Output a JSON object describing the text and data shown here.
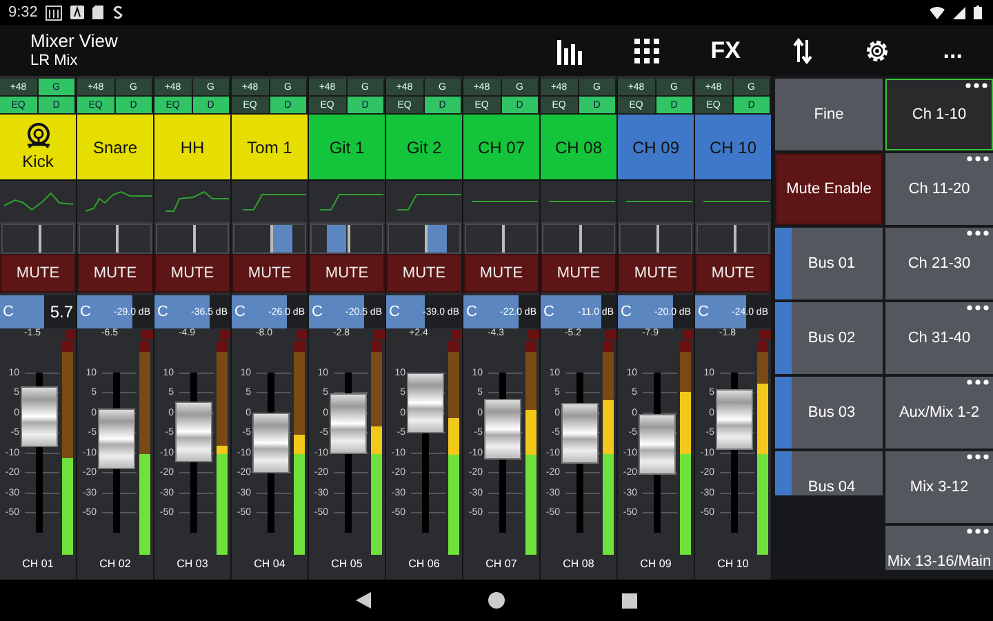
{
  "status_bar": {
    "time": "9:32"
  },
  "app_bar": {
    "title": "Mixer View",
    "subtitle": "LR Mix",
    "actions": [
      {
        "kind": "meters"
      },
      {
        "kind": "grid"
      },
      {
        "kind": "text",
        "label": "FX"
      },
      {
        "kind": "swap"
      },
      {
        "kind": "settings"
      },
      {
        "kind": "text",
        "label": "..."
      }
    ]
  },
  "channels": [
    {
      "phantom": {
        "label": "+48",
        "on": false
      },
      "gate": {
        "label": "G",
        "on": true
      },
      "eq": {
        "label": "EQ",
        "on": true
      },
      "dyn": {
        "label": "D",
        "on": true
      },
      "name": "Kick",
      "color": "#e6de00",
      "icon": true,
      "eq_graph": {
        "kind": "peaking"
      },
      "width_indicator": {
        "kind": "none"
      },
      "mute": {
        "label": "MUTE",
        "on": false
      },
      "trim": {
        "pan": "C",
        "text": "5.7",
        "level": 0.58,
        "selected": true
      },
      "readout": "-1.5",
      "scale": [
        "10",
        "5",
        "0",
        "-5",
        "-10",
        "-20",
        "-30",
        "-50"
      ],
      "fader": {
        "level": 0.72
      },
      "meter": {
        "level": 0.45
      },
      "label": "CH 01"
    },
    {
      "phantom": {
        "label": "+48",
        "on": false
      },
      "gate": {
        "label": "G",
        "on": false
      },
      "eq": {
        "label": "EQ",
        "on": true
      },
      "dyn": {
        "label": "D",
        "on": true
      },
      "name": "Snare",
      "color": "#e6de00",
      "icon": false,
      "eq_graph": {
        "kind": "shelf"
      },
      "width_indicator": {
        "kind": "none"
      },
      "mute": {
        "label": "MUTE",
        "on": false
      },
      "trim": {
        "pan": "C",
        "text": "-29.0 dB",
        "level": 0.72,
        "selected": false
      },
      "readout": "-6.5",
      "scale": [
        "10",
        "5",
        "0",
        "-5",
        "-10",
        "-20",
        "-30",
        "-50"
      ],
      "fader": {
        "level": 0.59
      },
      "meter": {
        "level": 0.47
      },
      "label": "CH 02"
    },
    {
      "phantom": {
        "label": "+48",
        "on": false
      },
      "gate": {
        "label": "G",
        "on": false
      },
      "eq": {
        "label": "EQ",
        "on": true
      },
      "dyn": {
        "label": "D",
        "on": true
      },
      "name": "HH",
      "color": "#e6de00",
      "icon": false,
      "eq_graph": {
        "kind": "highpass-bump"
      },
      "width_indicator": {
        "kind": "none"
      },
      "mute": {
        "label": "MUTE",
        "on": false
      },
      "trim": {
        "pan": "C",
        "text": "-36.5 dB",
        "level": 0.72,
        "selected": false
      },
      "readout": "-4.9",
      "scale": [
        "10",
        "5",
        "0",
        "-5",
        "-10",
        "-20",
        "-30",
        "-50"
      ],
      "fader": {
        "level": 0.63
      },
      "meter": {
        "level": 0.51
      },
      "label": "CH 03"
    },
    {
      "phantom": {
        "label": "+48",
        "on": false
      },
      "gate": {
        "label": "G",
        "on": false
      },
      "eq": {
        "label": "EQ",
        "on": false
      },
      "dyn": {
        "label": "D",
        "on": true
      },
      "name": "Tom 1",
      "color": "#e6de00",
      "icon": false,
      "eq_graph": {
        "kind": "highpass"
      },
      "width_indicator": {
        "kind": "right"
      },
      "mute": {
        "label": "MUTE",
        "on": false
      },
      "trim": {
        "pan": "C",
        "text": "-26.0 dB",
        "level": 0.72,
        "selected": false
      },
      "readout": "-8.0",
      "scale": [
        "10",
        "5",
        "0",
        "-5",
        "-10",
        "-20",
        "-30",
        "-50"
      ],
      "fader": {
        "level": 0.56
      },
      "meter": {
        "level": 0.56
      },
      "label": "CH 04"
    },
    {
      "phantom": {
        "label": "+48",
        "on": false
      },
      "gate": {
        "label": "G",
        "on": false
      },
      "eq": {
        "label": "EQ",
        "on": false
      },
      "dyn": {
        "label": "D",
        "on": true
      },
      "name": "Git 1",
      "color": "#14c43a",
      "icon": false,
      "eq_graph": {
        "kind": "highpass"
      },
      "width_indicator": {
        "kind": "left"
      },
      "mute": {
        "label": "MUTE",
        "on": false
      },
      "trim": {
        "pan": "C",
        "text": "-20.5 dB",
        "level": 0.72,
        "selected": false
      },
      "readout": "-2.8",
      "scale": [
        "10",
        "5",
        "0",
        "-5",
        "-10",
        "-20",
        "-30",
        "-50"
      ],
      "fader": {
        "level": 0.68
      },
      "meter": {
        "level": 0.6
      },
      "label": "CH 05"
    },
    {
      "phantom": {
        "label": "+48",
        "on": false
      },
      "gate": {
        "label": "G",
        "on": false
      },
      "eq": {
        "label": "EQ",
        "on": false
      },
      "dyn": {
        "label": "D",
        "on": true
      },
      "name": "Git 2",
      "color": "#14c43a",
      "icon": false,
      "eq_graph": {
        "kind": "highpass"
      },
      "width_indicator": {
        "kind": "right"
      },
      "mute": {
        "label": "MUTE",
        "on": false
      },
      "trim": {
        "pan": "C",
        "text": "-39.0 dB",
        "level": 0.5,
        "selected": false
      },
      "readout": "+2.4",
      "scale": [
        "10",
        "5",
        "0",
        "-5",
        "-10",
        "-20",
        "-30",
        "-50"
      ],
      "fader": {
        "level": 0.81
      },
      "meter": {
        "level": 0.64
      },
      "label": "CH 06"
    },
    {
      "phantom": {
        "label": "+48",
        "on": false
      },
      "gate": {
        "label": "G",
        "on": false
      },
      "eq": {
        "label": "EQ",
        "on": false
      },
      "dyn": {
        "label": "D",
        "on": true
      },
      "name": "CH 07",
      "color": "#14c43a",
      "icon": false,
      "eq_graph": {
        "kind": "flat"
      },
      "width_indicator": {
        "kind": "none"
      },
      "mute": {
        "label": "MUTE",
        "on": false
      },
      "trim": {
        "pan": "C",
        "text": "-22.0 dB",
        "level": 0.72,
        "selected": false
      },
      "readout": "-4.3",
      "scale": [
        "10",
        "5",
        "0",
        "-5",
        "-10",
        "-20",
        "-30",
        "-50"
      ],
      "fader": {
        "level": 0.65
      },
      "meter": {
        "level": 0.68
      },
      "label": "CH 07"
    },
    {
      "phantom": {
        "label": "+48",
        "on": false
      },
      "gate": {
        "label": "G",
        "on": false
      },
      "eq": {
        "label": "EQ",
        "on": false
      },
      "dyn": {
        "label": "D",
        "on": true
      },
      "name": "CH 08",
      "color": "#14c43a",
      "icon": false,
      "eq_graph": {
        "kind": "flat"
      },
      "width_indicator": {
        "kind": "none"
      },
      "mute": {
        "label": "MUTE",
        "on": false
      },
      "trim": {
        "pan": "C",
        "text": "-11.0 dB",
        "level": 0.8,
        "selected": false
      },
      "readout": "-5.2",
      "scale": [
        "10",
        "5",
        "0",
        "-5",
        "-10",
        "-20",
        "-30",
        "-50"
      ],
      "fader": {
        "level": 0.62
      },
      "meter": {
        "level": 0.72
      },
      "label": "CH 08"
    },
    {
      "phantom": {
        "label": "+48",
        "on": false
      },
      "gate": {
        "label": "G",
        "on": false
      },
      "eq": {
        "label": "EQ",
        "on": false
      },
      "dyn": {
        "label": "D",
        "on": true
      },
      "name": "CH 09",
      "color": "#3f78c8",
      "icon": false,
      "eq_graph": {
        "kind": "flat"
      },
      "width_indicator": {
        "kind": "none"
      },
      "mute": {
        "label": "MUTE",
        "on": false
      },
      "trim": {
        "pan": "C",
        "text": "-20.0 dB",
        "level": 0.72,
        "selected": false
      },
      "readout": "-7.9",
      "scale": [
        "10",
        "5",
        "0",
        "-5",
        "-10",
        "-20",
        "-30",
        "-50"
      ],
      "fader": {
        "level": 0.55
      },
      "meter": {
        "level": 0.76
      },
      "label": "CH 09"
    },
    {
      "phantom": {
        "label": "+48",
        "on": false
      },
      "gate": {
        "label": "G",
        "on": false
      },
      "eq": {
        "label": "EQ",
        "on": false
      },
      "dyn": {
        "label": "D",
        "on": true
      },
      "name": "CH 10",
      "color": "#3f78c8",
      "icon": false,
      "eq_graph": {
        "kind": "flat"
      },
      "width_indicator": {
        "kind": "none"
      },
      "mute": {
        "label": "MUTE",
        "on": false
      },
      "trim": {
        "pan": "C",
        "text": "-24.0 dB",
        "level": 0.68,
        "selected": false
      },
      "readout": "-1.8",
      "scale": [
        "10",
        "5",
        "0",
        "-5",
        "-10",
        "-20",
        "-30",
        "-50"
      ],
      "fader": {
        "level": 0.71
      },
      "meter": {
        "level": 0.8
      },
      "label": "CH 10"
    }
  ],
  "controls": [
    {
      "kind": "plain",
      "label": "Fine"
    },
    {
      "kind": "mute",
      "label": "Mute Enable"
    },
    {
      "kind": "bus",
      "label": "Bus 01",
      "color": "#3f78c8"
    },
    {
      "kind": "bus",
      "label": "Bus 02",
      "color": "#3f78c8"
    },
    {
      "kind": "bus",
      "label": "Bus 03",
      "color": "#3f78c8"
    },
    {
      "kind": "bus",
      "label": "Bus 04",
      "color": "#3f78c8"
    }
  ],
  "banks": [
    {
      "label": "Ch 1-10",
      "selected": true
    },
    {
      "label": "Ch 11-20",
      "selected": false
    },
    {
      "label": "Ch 21-30",
      "selected": false
    },
    {
      "label": "Ch 31-40",
      "selected": false
    },
    {
      "label": "Aux/Mix 1-2",
      "selected": false
    },
    {
      "label": "Mix 3-12",
      "selected": false
    },
    {
      "label": "Mix 13-16/Main",
      "selected": false
    }
  ]
}
